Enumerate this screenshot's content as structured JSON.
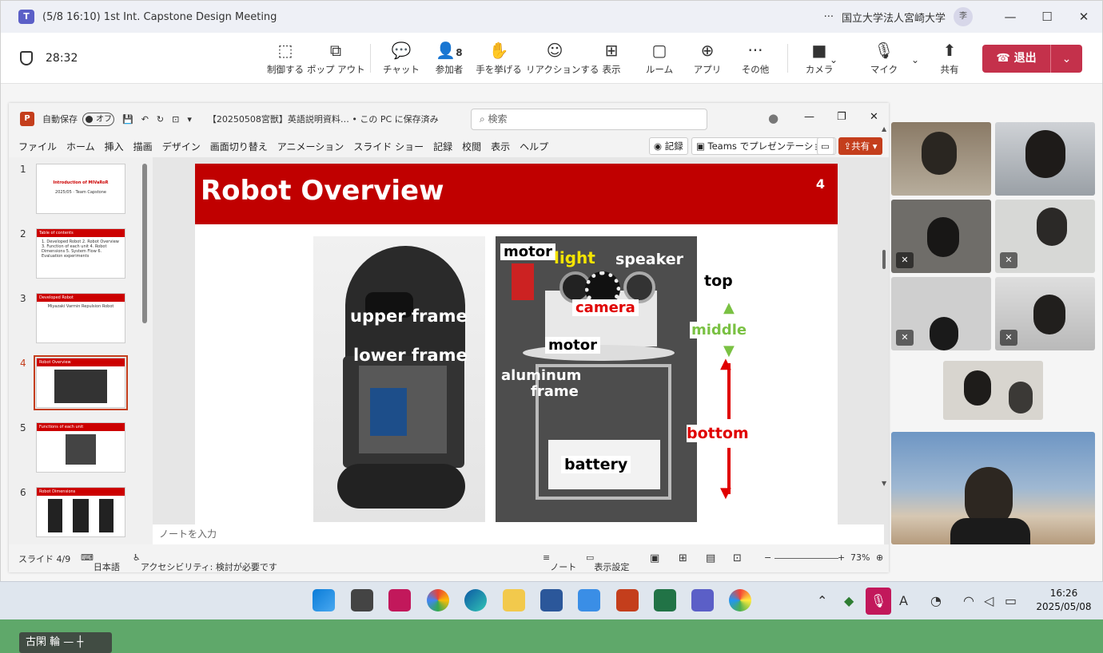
{
  "window": {
    "app_icon": "teams-icon",
    "title": "(5/8 16:10) 1st Int. Capstone Design Meeting",
    "org": "国立大学法人宮崎大学",
    "user_initial": "李"
  },
  "toolbar": {
    "timer": "28:32",
    "buttons": [
      {
        "label": "制御する",
        "icon": "control-icon"
      },
      {
        "label": "ポップ アウト",
        "icon": "popout-icon"
      },
      {
        "label": "チャット",
        "icon": "chat-icon"
      },
      {
        "label": "参加者",
        "icon": "people-icon",
        "count": "8"
      },
      {
        "label": "手を挙げる",
        "icon": "raise-hand-icon"
      },
      {
        "label": "リアクションする",
        "icon": "smile-icon"
      },
      {
        "label": "表示",
        "icon": "view-icon"
      },
      {
        "label": "ルーム",
        "icon": "rooms-icon"
      },
      {
        "label": "アプリ",
        "icon": "apps-icon"
      },
      {
        "label": "その他",
        "icon": "more-icon"
      },
      {
        "label": "カメラ",
        "icon": "camera-icon"
      },
      {
        "label": "マイク",
        "icon": "mic-icon"
      },
      {
        "label": "共有",
        "icon": "share-icon"
      }
    ],
    "leave_label": "退出"
  },
  "ppt": {
    "autosave": "自動保存",
    "autosave_state": "オフ",
    "filename": "【20250508宮獣】英語説明資料… • この PC に保存済み",
    "search_placeholder": "検索",
    "menu": [
      "ファイル",
      "ホーム",
      "挿入",
      "描画",
      "デザイン",
      "画面切り替え",
      "アニメーション",
      "スライド ショー",
      "記録",
      "校閲",
      "表示",
      "ヘルプ"
    ],
    "record_btn": "記録",
    "teams_btn": "Teams でプレゼンテーション",
    "share_btn": "共有",
    "notes_placeholder": "ノートを入力",
    "status": {
      "slide_info": "スライド 4/9",
      "language": "日本語",
      "accessibility": "アクセシビリティ: 検討が必要です",
      "notes": "ノート",
      "display_settings": "表示設定",
      "zoom": "73%"
    }
  },
  "thumbnails": [
    {
      "num": "1",
      "title": "Introduction of MIVaRoR",
      "text": "2025/05 · Team Capstone"
    },
    {
      "num": "2",
      "title": "Table of contents",
      "text": "1. Developed Robot 2. Robot Overview 3. Function of each unit 4. Robot Dimensions 5. System Flow 6. Evaluation experiments"
    },
    {
      "num": "3",
      "title": "Developed Robot",
      "text": "Miyazaki Varmin Repulsion Robot"
    },
    {
      "num": "4",
      "title": "Robot Overview",
      "text": ""
    },
    {
      "num": "5",
      "title": "Functions of each unit",
      "text": ""
    },
    {
      "num": "6",
      "title": "Robot Dimensions",
      "text": ""
    }
  ],
  "slide": {
    "title": "Robot Overview",
    "number": "4",
    "labels_left": [
      "upper frame",
      "lower frame"
    ],
    "labels_right": {
      "motor_top": "motor",
      "light": "light",
      "speaker": "speaker",
      "camera": "camera",
      "motor_mid": "motor",
      "aluminum": "aluminum",
      "frame": "frame",
      "battery": "battery"
    },
    "sections": {
      "top": "top",
      "middle": "middle",
      "bottom": "bottom"
    },
    "colors": {
      "light": "#f5e400",
      "camera": "#e00000",
      "middle": "#7ac143",
      "bottom": "#e00000"
    }
  },
  "participants": {
    "caption": "古閑 輪"
  },
  "taskbar": {
    "time": "16:26",
    "date": "2025/05/08"
  }
}
